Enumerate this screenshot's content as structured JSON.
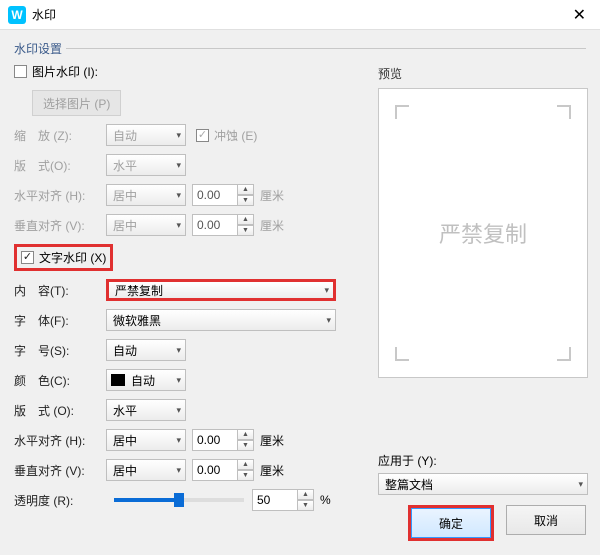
{
  "title": "水印",
  "group": "水印设置",
  "image_wm": {
    "cb_label": "图片水印 (I):",
    "select_pic": "选择图片 (P)",
    "zoom_label": "缩　放 (Z):",
    "zoom_value": "自动",
    "erode_label": "冲蚀 (E)",
    "layout_label": "版　式(O):",
    "layout_value": "水平",
    "halign_label": "水平对齐 (H):",
    "halign_value": "居中",
    "halign_num": "0.00",
    "valign_label": "垂直对齐 (V):",
    "valign_value": "居中",
    "valign_num": "0.00",
    "unit": "厘米"
  },
  "text_wm": {
    "cb_label": "文字水印 (X)",
    "content_label": "内　容(T):",
    "content_value": "严禁复制",
    "font_label": "字　体(F):",
    "font_value": "微软雅黑",
    "size_label": "字　号(S):",
    "size_value": "自动",
    "color_label": "颜　色(C):",
    "color_value": "自动",
    "layout_label": "版　式 (O):",
    "layout_value": "水平",
    "halign_label": "水平对齐 (H):",
    "halign_value": "居中",
    "halign_num": "0.00",
    "valign_label": "垂直对齐 (V):",
    "valign_value": "居中",
    "valign_num": "0.00",
    "opacity_label": "透明度 (R):",
    "opacity_value": "50",
    "opacity_pct": 50,
    "unit": "厘米",
    "pct": "%"
  },
  "preview": {
    "label": "预览",
    "text": "严禁复制"
  },
  "apply": {
    "label": "应用于 (Y):",
    "value": "整篇文档"
  },
  "buttons": {
    "ok": "确定",
    "cancel": "取消"
  }
}
